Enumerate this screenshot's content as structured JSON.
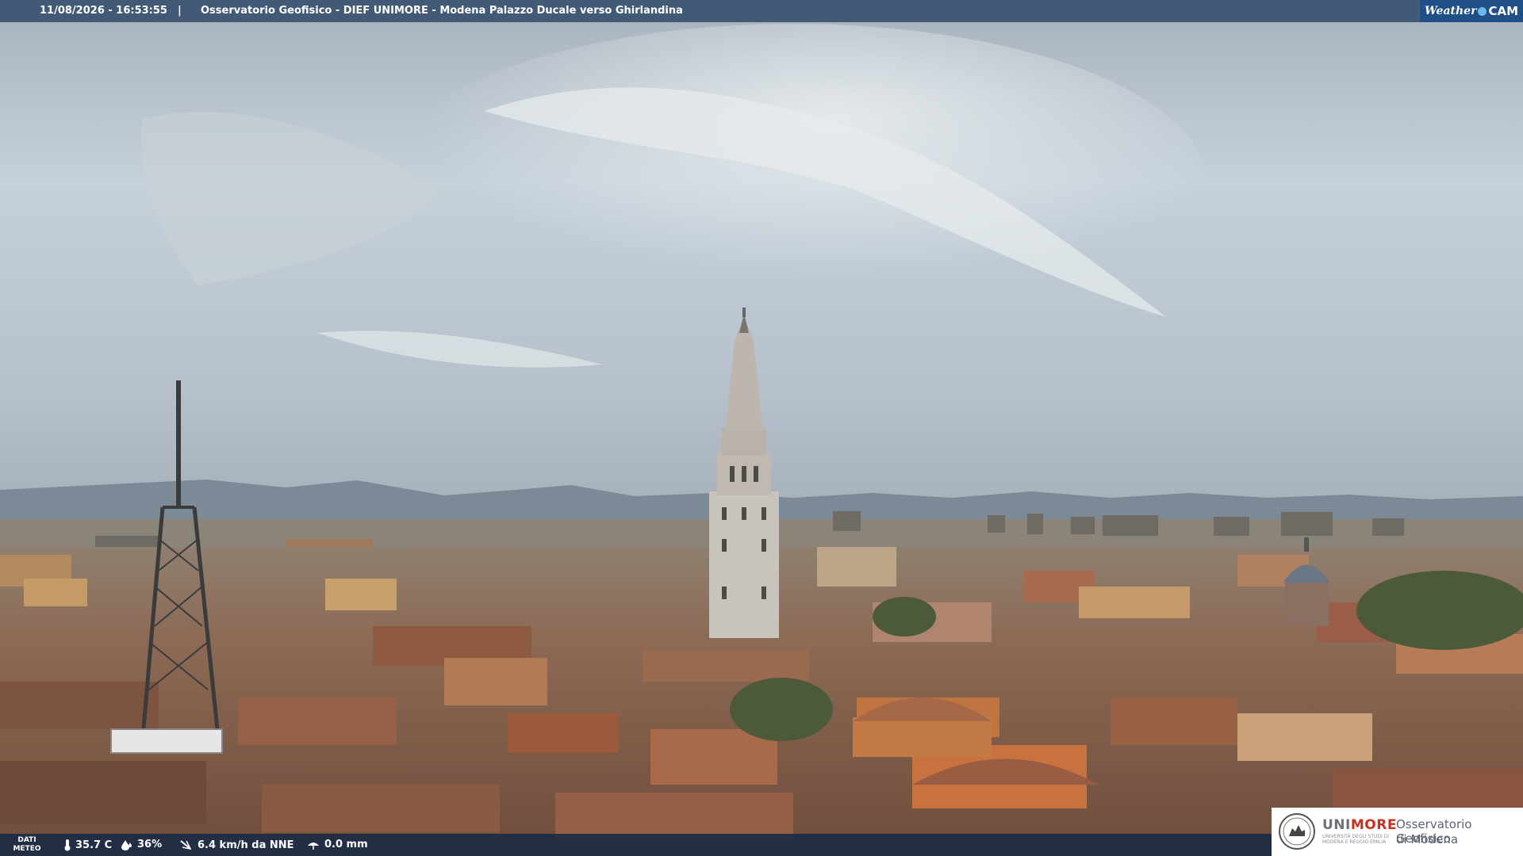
{
  "overlay": {
    "datetime": "11/08/2026 - 16:53:55",
    "separator": "|",
    "title": "Osservatorio Geofisico - DIEF UNIMORE - Modena Palazzo Ducale verso Ghirlandina",
    "brand_weather": "Weather",
    "brand_cam": "CAM"
  },
  "meteo": {
    "label_line1": "DATI",
    "label_line2": "METEO",
    "temperature": "35.7 C",
    "humidity": "36%",
    "wind": "6.4 km/h da NNE",
    "rain": "0.0 mm"
  },
  "logo": {
    "uni_prefix": "UNI",
    "uni_suffix": "MORE",
    "uni_sub": "UNIVERSITÀ DEGLI STUDI DI MODENA E REGGIO EMILIA",
    "obs_line1": "Osservatorio Geofisico",
    "obs_line2": "di Modena"
  },
  "colors": {
    "topbar": "#3a5270",
    "accent_red": "#c8301f"
  },
  "icons": [
    "thermometer-icon",
    "humidity-drop-icon",
    "wind-icon",
    "rain-gauge-icon",
    "unimore-seal-icon"
  ]
}
